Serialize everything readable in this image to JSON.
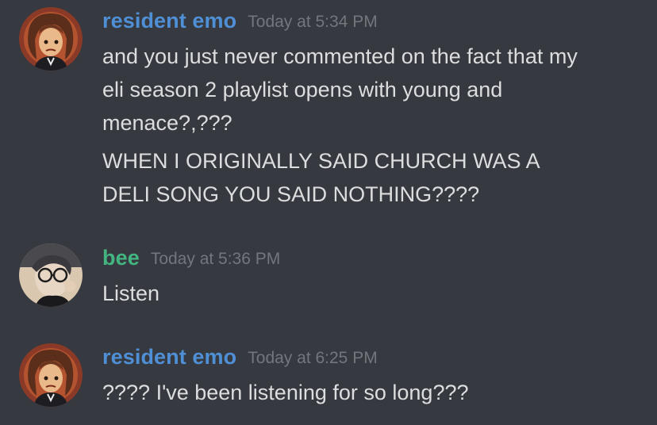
{
  "messages": [
    {
      "username": "resident emo",
      "username_color": "#4f8fd6",
      "timestamp": "Today at 5:34 PM",
      "avatar": "avatar-curly-hair-character",
      "lines": [
        "and you just never commented on the fact that my",
        "eli season 2 playlist opens with young and",
        "menace?,???",
        "WHEN I ORIGINALLY SAID CHURCH WAS A",
        "DELI SONG YOU SAID NOTHING????"
      ]
    },
    {
      "username": "bee",
      "username_color": "#43b581",
      "timestamp": "Today at 5:36 PM",
      "avatar": "avatar-photo-glasses",
      "lines": [
        "Listen"
      ]
    },
    {
      "username": "resident emo",
      "username_color": "#4f8fd6",
      "timestamp": "Today at 6:25 PM",
      "avatar": "avatar-curly-hair-character",
      "lines": [
        "???? I've been listening for so long???"
      ]
    }
  ]
}
